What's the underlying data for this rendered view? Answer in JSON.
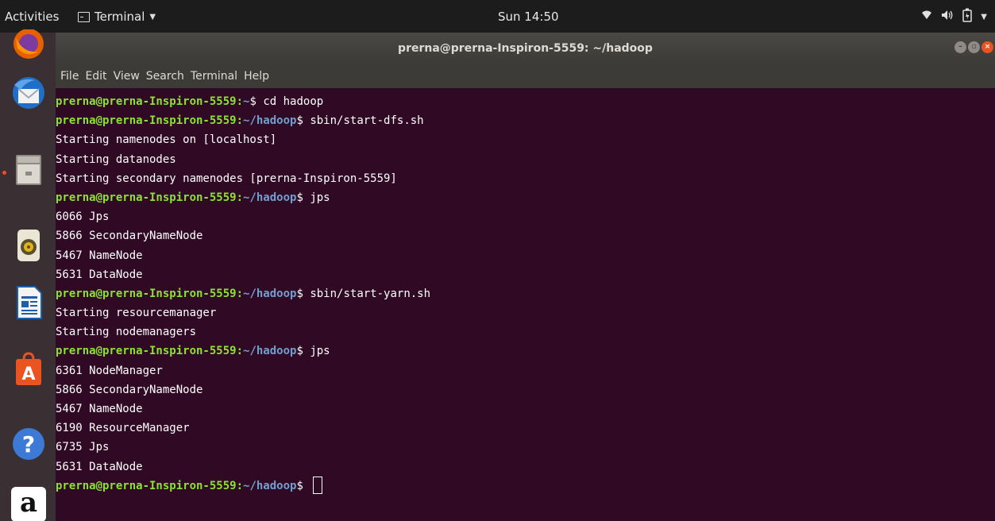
{
  "topbar": {
    "activities": "Activities",
    "app_menu": "Terminal",
    "clock": "Sun 14:50"
  },
  "window": {
    "title": "prerna@prerna-Inspiron-5559: ~/hadoop"
  },
  "menubar": {
    "items": [
      "File",
      "Edit",
      "View",
      "Search",
      "Terminal",
      "Help"
    ]
  },
  "terminal": {
    "lines": [
      {
        "user": "prerna@prerna-Inspiron-5559:",
        "path": "~",
        "sym": "$ ",
        "text": "cd hadoop"
      },
      {
        "user": "prerna@prerna-Inspiron-5559:",
        "path": "~/hadoop",
        "sym": "$ ",
        "text": "sbin/start-dfs.sh"
      },
      {
        "text": "Starting namenodes on [localhost]"
      },
      {
        "text": "Starting datanodes"
      },
      {
        "text": "Starting secondary namenodes [prerna-Inspiron-5559]"
      },
      {
        "user": "prerna@prerna-Inspiron-5559:",
        "path": "~/hadoop",
        "sym": "$ ",
        "text": "jps"
      },
      {
        "text": "6066 Jps"
      },
      {
        "text": "5866 SecondaryNameNode"
      },
      {
        "text": "5467 NameNode"
      },
      {
        "text": "5631 DataNode"
      },
      {
        "user": "prerna@prerna-Inspiron-5559:",
        "path": "~/hadoop",
        "sym": "$ ",
        "text": "sbin/start-yarn.sh"
      },
      {
        "text": "Starting resourcemanager"
      },
      {
        "text": "Starting nodemanagers"
      },
      {
        "user": "prerna@prerna-Inspiron-5559:",
        "path": "~/hadoop",
        "sym": "$ ",
        "text": "jps"
      },
      {
        "text": "6361 NodeManager"
      },
      {
        "text": "5866 SecondaryNameNode"
      },
      {
        "text": "5467 NameNode"
      },
      {
        "text": "6190 ResourceManager"
      },
      {
        "text": "6735 Jps"
      },
      {
        "text": "5631 DataNode"
      },
      {
        "user": "prerna@prerna-Inspiron-5559:",
        "path": "~/hadoop",
        "sym": "$ ",
        "text": "",
        "cursor": true
      }
    ]
  },
  "dock": {
    "icons": [
      "firefox-icon",
      "thunderbird-icon",
      "files-icon",
      "rhythmbox-icon",
      "libreoffice-writer-icon",
      "software-center-icon",
      "help-icon",
      "amazon-icon"
    ],
    "help_glyph": "?",
    "amazon_glyph": "a",
    "software_glyph": "A"
  },
  "colors": {
    "terminal_bg": "#300a24",
    "prompt_user": "#8ae234",
    "prompt_path": "#729fcf",
    "close_button": "#e95420"
  }
}
